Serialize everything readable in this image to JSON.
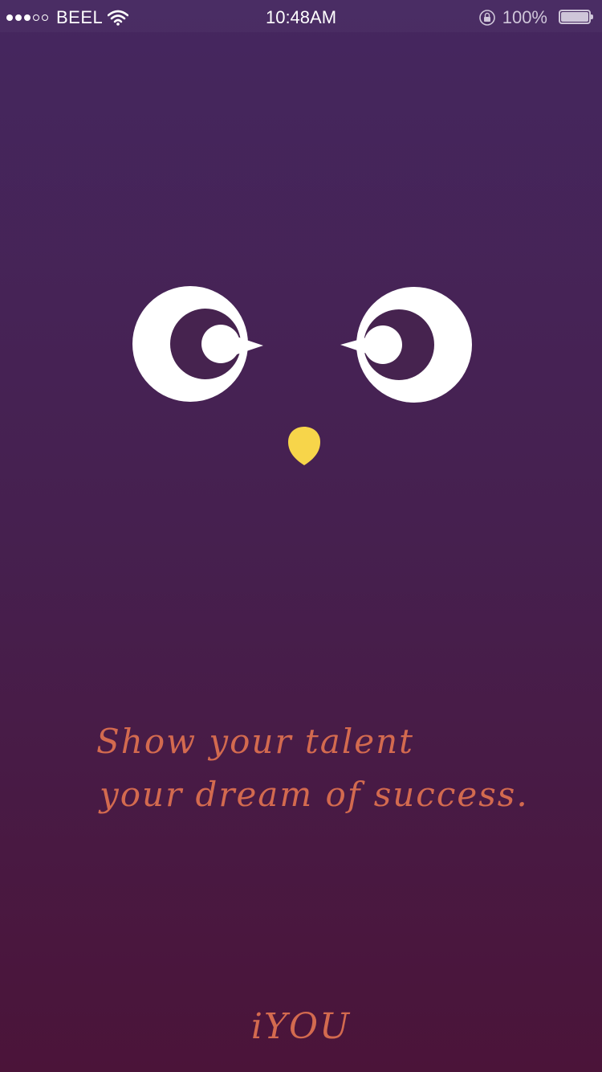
{
  "status_bar": {
    "carrier": "BEEL",
    "time": "10:48AM",
    "battery_percent": "100%",
    "signal_bars_filled": 3,
    "signal_bars_total": 5
  },
  "splash": {
    "tagline_line1": "Show your talent",
    "tagline_line2": "your dream of success.",
    "brand": "iYOU"
  },
  "colors": {
    "background_top": "#45275f",
    "background_bottom": "#4b1439",
    "accent_text": "#d36a4f",
    "beak": "#f7d54a",
    "eyes": "#ffffff"
  },
  "icons": [
    "wifi-icon",
    "lock-rotation-icon",
    "battery-icon",
    "owl-eye-icon",
    "owl-beak-icon"
  ]
}
